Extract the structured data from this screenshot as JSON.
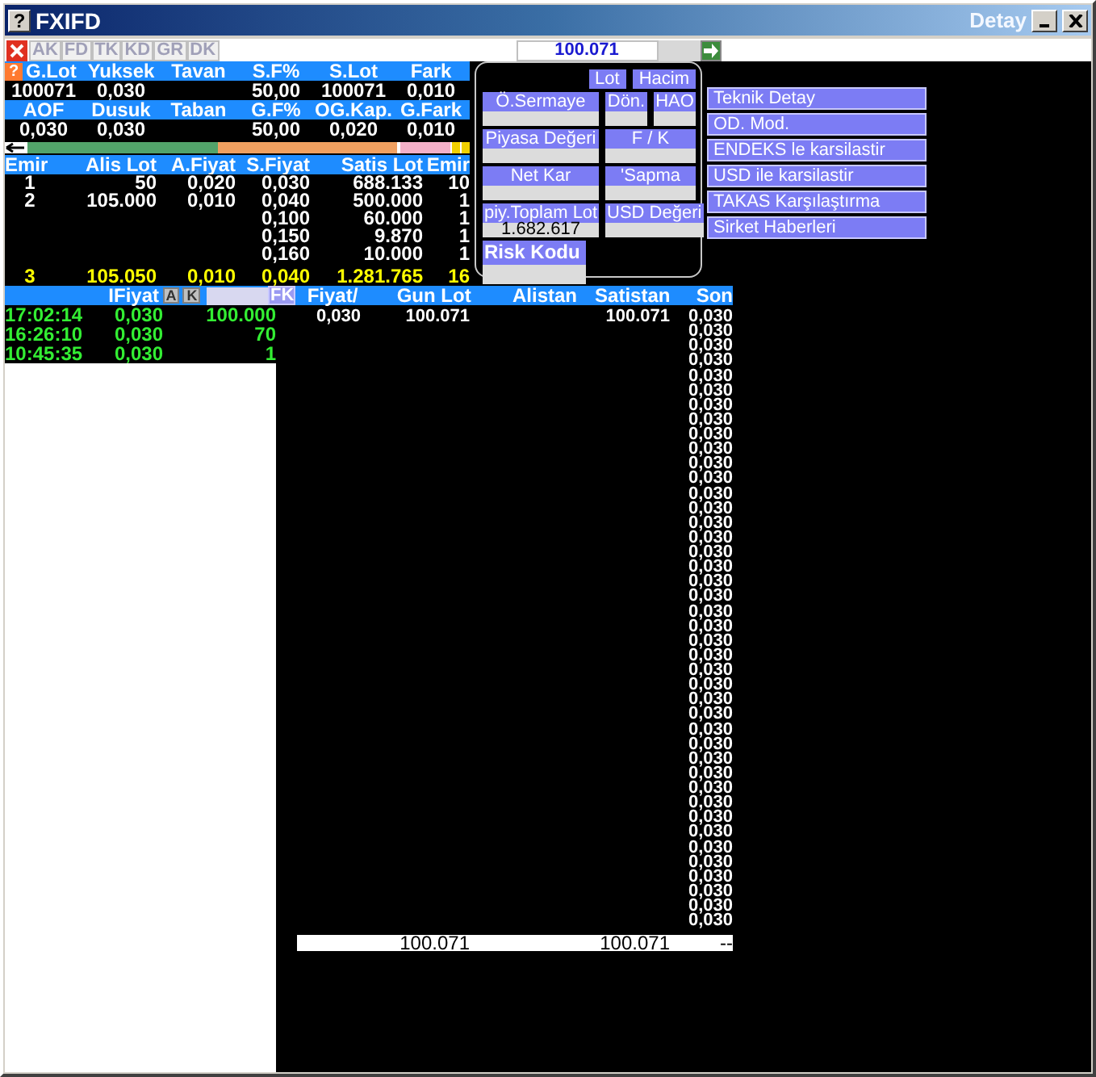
{
  "window": {
    "help_label": "?",
    "title": "FXIFD",
    "subtitle": "Detay"
  },
  "toolbar": {
    "buttons": [
      {
        "label": "AK",
        "disabled": true
      },
      {
        "label": "FD",
        "disabled": true
      },
      {
        "label": "TK",
        "disabled": true
      },
      {
        "label": "KD",
        "disabled": true
      },
      {
        "label": "GR",
        "disabled": true
      },
      {
        "label": "DK",
        "disabled": true
      }
    ],
    "amount_field": {
      "value": "100.071"
    }
  },
  "quote": {
    "help_label": "?",
    "blocks": [
      [
        {
          "header": "G.Lot",
          "value": "100071"
        },
        {
          "header": "Yuksek",
          "value": "0,030"
        },
        {
          "header": "Tavan"
        },
        {
          "header": "S.F%",
          "value": "50,00"
        },
        {
          "header": "S.Lot",
          "value": "100071"
        },
        {
          "header": "Fark",
          "value": "0,010"
        }
      ],
      [
        {
          "header": "AOF",
          "value": "0,030"
        },
        {
          "header": "Dusuk",
          "value": "0,030"
        },
        {
          "header": "Taban"
        },
        {
          "header": "G.F%",
          "value": "50,00"
        },
        {
          "header": "OG.Kap.",
          "value": "0,020"
        },
        {
          "header": "G.Fark",
          "value": "0,010"
        }
      ]
    ]
  },
  "depth": {
    "columns": [
      "Emir",
      "Alis Lot",
      "A.Fiyat",
      "S.Fiyat",
      "Satis Lot",
      "Emir"
    ],
    "rows": [
      {
        "buy_orders": "1",
        "buy_lot": "50",
        "buy_price": "0,020",
        "sell_price": "0,030",
        "sell_lot": "688.133",
        "sell_orders": "10"
      },
      {
        "buy_orders": "2",
        "buy_lot": "105.000",
        "buy_price": "0,010",
        "sell_price": "0,040",
        "sell_lot": "500.000",
        "sell_orders": "1"
      },
      {
        "sell_price": "0,100",
        "sell_lot": "60.000",
        "sell_orders": "1"
      },
      {
        "sell_price": "0,150",
        "sell_lot": "9.870",
        "sell_orders": "1"
      },
      {
        "sell_price": "0,160",
        "sell_lot": "10.000",
        "sell_orders": "1"
      }
    ],
    "total": {
      "buy_orders": "3",
      "buy_lot": "105.050",
      "buy_price": "0,010",
      "sell_price": "0,040",
      "sell_lot": "1.281.765",
      "sell_orders": "16"
    }
  },
  "info_panel": {
    "toggles": [
      "Lot",
      "Hacim"
    ],
    "rows": [
      [
        {
          "label": "Ö.Sermaye"
        },
        {
          "label": "Dön."
        },
        {
          "label": "HAO"
        }
      ],
      [
        {
          "label": "Piyasa Değeri"
        },
        {
          "label": "F / K"
        }
      ],
      [
        {
          "label": "Net Kar"
        },
        {
          "label": "'Sapma"
        }
      ],
      [
        {
          "label": "piy.Toplam Lot",
          "value": "1.682.617"
        },
        {
          "label": "USD Değeri"
        }
      ]
    ],
    "risk": {
      "label": "Risk Kodu"
    }
  },
  "menu": [
    "Teknik Detay",
    "OD. Mod.",
    "ENDEKS le karsilastir",
    "USD ile karsilastir",
    "TAKAS Karşılaştırma",
    "Sirket Haberleri"
  ],
  "time_sales": {
    "column": "IFiyat",
    "filters": [
      "A",
      "K"
    ],
    "fk_button": "FK",
    "rows": [
      {
        "time": "17:02:14",
        "price": "0,030",
        "lot": "100.000"
      },
      {
        "time": "16:26:10",
        "price": "0,030",
        "lot": "70"
      },
      {
        "time": "10:45:35",
        "price": "0,030",
        "lot": "1"
      }
    ]
  },
  "trades": {
    "columns": [
      "Fiyat/",
      "Gun Lot",
      "Alistan",
      "Satistan",
      "Son"
    ],
    "rows": [
      {
        "price": "0,030",
        "day_lot": "100.071",
        "seller": "100.071",
        "last": "0,030"
      },
      {
        "last": "0,030"
      },
      {
        "last": "0,030"
      },
      {
        "last": "0,030"
      },
      {
        "last": "0,030"
      },
      {
        "last": "0,030"
      },
      {
        "last": "0,030"
      },
      {
        "last": "0,030"
      },
      {
        "last": "0,030"
      },
      {
        "last": "0,030"
      },
      {
        "last": "0,030"
      },
      {
        "last": "0,030"
      },
      {
        "last": "0,030"
      },
      {
        "last": "0,030"
      },
      {
        "last": "0,030"
      },
      {
        "last": "0,030"
      },
      {
        "last": "0,030"
      },
      {
        "last": "0,030"
      },
      {
        "last": "0,030"
      },
      {
        "last": "0,030"
      },
      {
        "last": "0,030"
      },
      {
        "last": "0,030"
      },
      {
        "last": "0,030"
      },
      {
        "last": "0,030"
      },
      {
        "last": "0,030"
      },
      {
        "last": "0,030"
      },
      {
        "last": "0,030"
      },
      {
        "last": "0,030"
      },
      {
        "last": "0,030"
      },
      {
        "last": "0,030"
      },
      {
        "last": "0,030"
      },
      {
        "last": "0,030"
      },
      {
        "last": "0,030"
      },
      {
        "last": "0,030"
      },
      {
        "last": "0,030"
      },
      {
        "last": "0,030"
      },
      {
        "last": "0,030"
      },
      {
        "last": "0,030"
      },
      {
        "last": "0,030"
      },
      {
        "last": "0,030"
      },
      {
        "last": "0,030"
      },
      {
        "last": "0,030"
      }
    ],
    "total": {
      "day_lot": "100.071",
      "seller": "100.071",
      "last": "--"
    }
  }
}
